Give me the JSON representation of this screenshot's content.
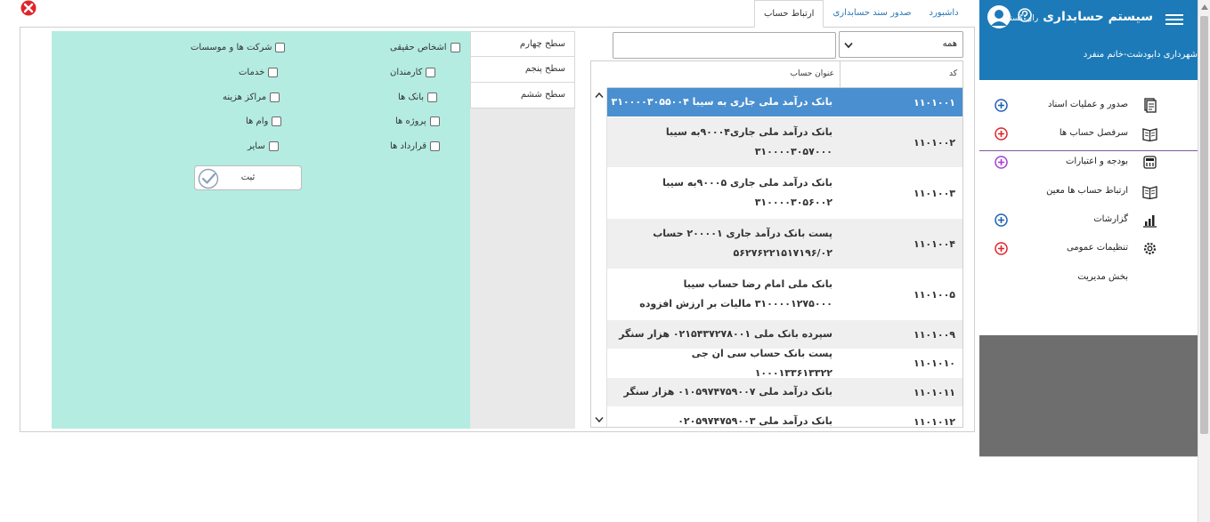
{
  "tabs": [
    {
      "label": "داشبورد"
    },
    {
      "label": "صدور سند حسابداری"
    },
    {
      "label": "ارتباط حساب"
    }
  ],
  "checkboxes": {
    "col_right": [
      "اشخاص حقیقی",
      "کارمندان",
      "بانک ها",
      "پروژه ها",
      "قرارداد ها"
    ],
    "col_left": [
      "شرکت ها و موسسات",
      "خدمات",
      "مراکز هزینه",
      "وام ها",
      "سایر"
    ]
  },
  "submit_label": "ثبت",
  "levels": [
    "سطح چهارم",
    "سطح پنجم",
    "سطح ششم"
  ],
  "filter": {
    "select_value": "همه",
    "search_value": ""
  },
  "table": {
    "headers": {
      "code": "کد",
      "title": "عنوان حساب"
    },
    "rows": [
      {
        "code": "۱۱۰۱۰۰۱",
        "title": "بانک درآمد ملی جاری به سیبا ۳۱۰۰۰۰۳۰۵۵۰۰۴"
      },
      {
        "code": "۱۱۰۱۰۰۲",
        "title": "بانک درآمد ملی جاری۹۰۰۰۴به سیبا ۳۱۰۰۰۰۳۰۵۷۰۰۰"
      },
      {
        "code": "۱۱۰۱۰۰۳",
        "title": "بانک درآمد ملی جاری ۹۰۰۰۵به سیبا ۳۱۰۰۰۰۳۰۵۶۰۰۲"
      },
      {
        "code": "۱۱۰۱۰۰۴",
        "title": "پست بانک درآمد جاری ۲۰۰۰۰۱ حساب ۵۶۲۷۶۲۲۱۵۱۷۱۹۶/۰۲"
      },
      {
        "code": "۱۱۰۱۰۰۵",
        "title": "بانک ملی امام رضا حساب سیبا ۳۱۰۰۰۰۱۲۷۵۰۰۰ مالیات بر ارزش افزوده"
      },
      {
        "code": "۱۱۰۱۰۰۹",
        "title": "سپرده بانک ملی ۰۲۱۵۴۳۷۲۷۸۰۰۱ هزار سنگر"
      },
      {
        "code": "۱۱۰۱۰۱۰",
        "title": "پست بانک حساب سی ان جی ۱۰۰۰۱۳۳۶۱۳۳۲۲"
      },
      {
        "code": "۱۱۰۱۰۱۱",
        "title": "بانک درآمد ملی ۰۱۰۵۹۷۴۷۵۹۰۰۷ هزار سنگر"
      },
      {
        "code": "۱۱۰۱۰۱۲",
        "title": "بانک درآمد ملی ۰۲۰۵۹۷۴۷۵۹۰۰۳"
      }
    ]
  },
  "sidebar": {
    "title": "سیستم حسابداری",
    "brand": "رای گستر",
    "subtitle": "شهرداری دابودشت-خانم منفرد",
    "items": [
      {
        "label": "صدور و عملیات اسناد",
        "icon": "documents-icon",
        "plus": "blue"
      },
      {
        "label": "سرفصل حساب ها",
        "icon": "book-icon",
        "plus": "red"
      },
      {
        "label": "بودجه و اعتبارات",
        "icon": "calculator-icon",
        "plus": "purple"
      },
      {
        "label": "ارتباط حساب ها معین",
        "icon": "book-icon",
        "plus": ""
      },
      {
        "label": "گزارشات",
        "icon": "bar-chart-icon",
        "plus": "blue"
      },
      {
        "label": "تنظیمات عمومی",
        "icon": "gear-icon",
        "plus": "red"
      },
      {
        "label": "بخش مدیریت",
        "icon": "",
        "plus": ""
      }
    ]
  },
  "colors": {
    "accent": "#1c7ab8",
    "selected_row": "#4a8fd0",
    "mint_panel": "#b4ece2",
    "plus_blue": "#1e5fb3",
    "plus_red": "#e0242b",
    "plus_purple": "#a23fd6"
  }
}
